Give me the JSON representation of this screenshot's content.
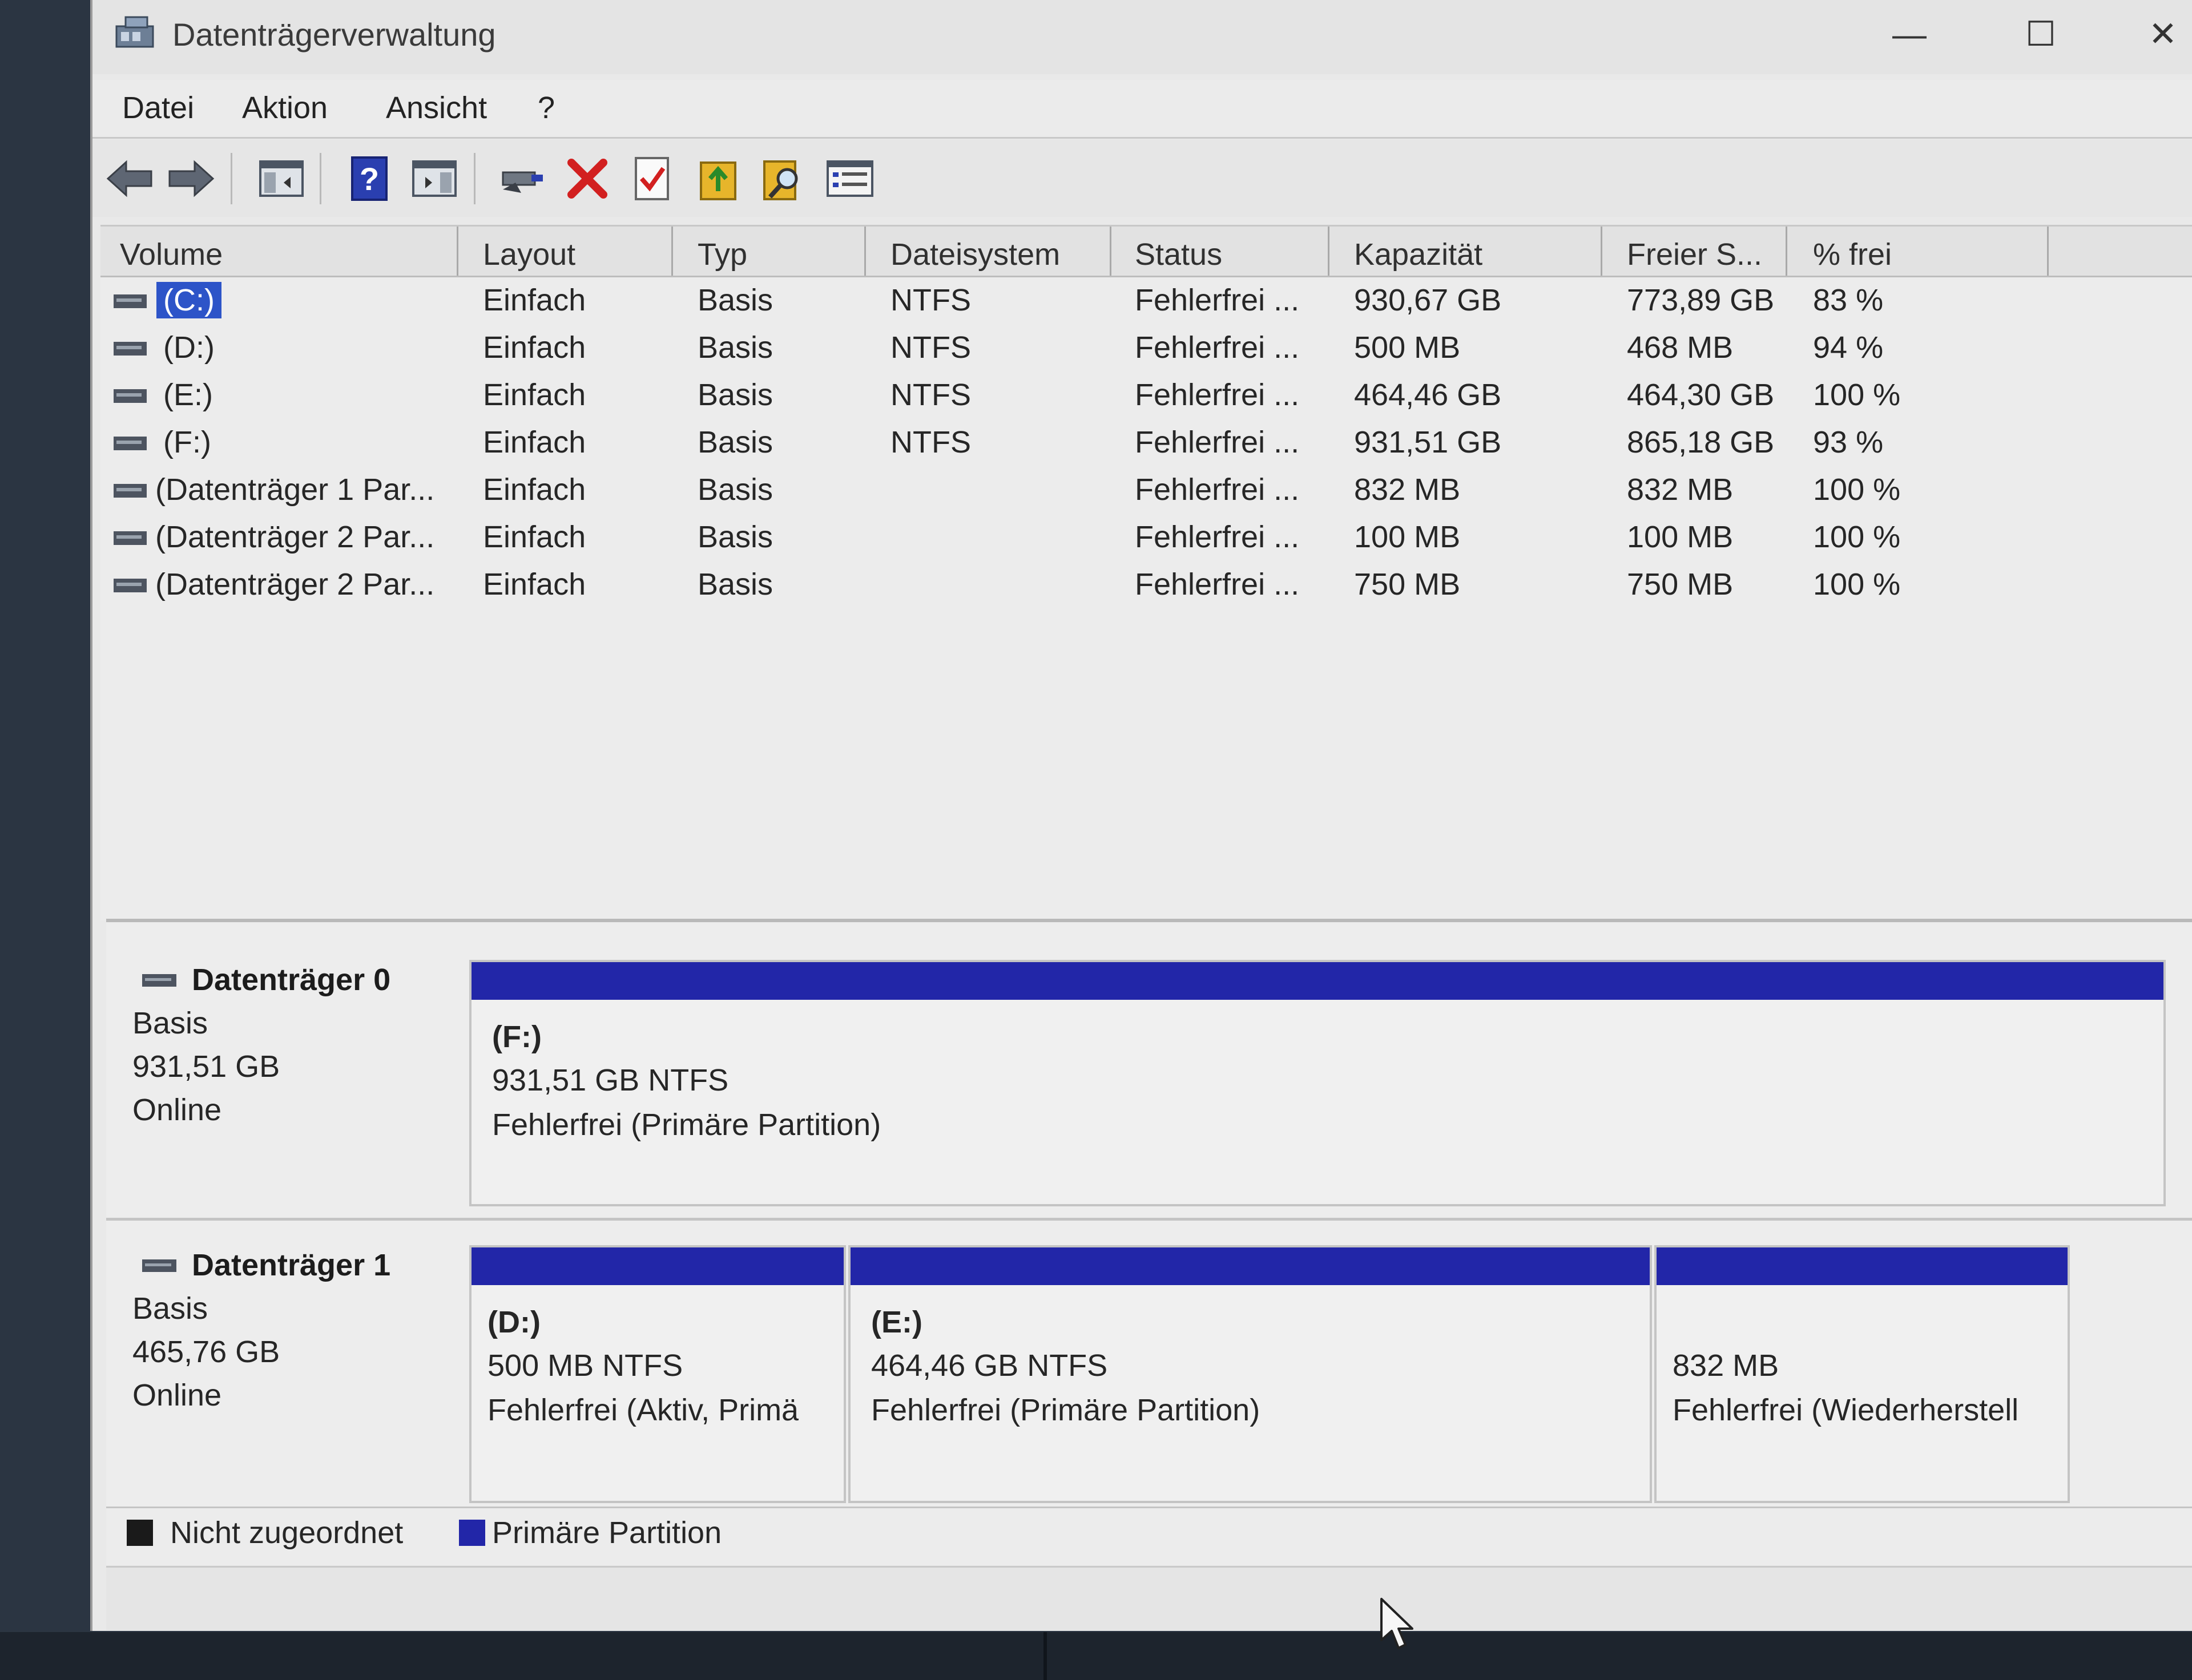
{
  "window": {
    "title": "Datenträgerverwaltung",
    "controls": {
      "minimize": "—",
      "maximize": "☐",
      "close": "✕"
    }
  },
  "menu": [
    "Datei",
    "Aktion",
    "Ansicht",
    "?"
  ],
  "toolbar": [
    "back-arrow-icon",
    "forward-arrow-icon",
    "console-tree-icon",
    "help-icon",
    "action-pane-icon",
    "connect-drive-icon",
    "delete-icon",
    "check-icon",
    "properties-export-icon",
    "search-icon",
    "list-view-icon"
  ],
  "columns": [
    "Volume",
    "Layout",
    "Typ",
    "Dateisystem",
    "Status",
    "Kapazität",
    "Freier S...",
    "% frei"
  ],
  "volumes": [
    {
      "volume": "(C:)",
      "layout": "Einfach",
      "type": "Basis",
      "fs": "NTFS",
      "status": "Fehlerfrei ...",
      "capacity": "930,67 GB",
      "free": "773,89 GB",
      "pct": "83 %"
    },
    {
      "volume": "(D:)",
      "layout": "Einfach",
      "type": "Basis",
      "fs": "NTFS",
      "status": "Fehlerfrei ...",
      "capacity": "500 MB",
      "free": "468 MB",
      "pct": "94 %"
    },
    {
      "volume": "(E:)",
      "layout": "Einfach",
      "type": "Basis",
      "fs": "NTFS",
      "status": "Fehlerfrei ...",
      "capacity": "464,46 GB",
      "free": "464,30 GB",
      "pct": "100 %"
    },
    {
      "volume": "(F:)",
      "layout": "Einfach",
      "type": "Basis",
      "fs": "NTFS",
      "status": "Fehlerfrei ...",
      "capacity": "931,51 GB",
      "free": "865,18 GB",
      "pct": "93 %"
    },
    {
      "volume": "(Datenträger 1 Par...",
      "layout": "Einfach",
      "type": "Basis",
      "fs": "",
      "status": "Fehlerfrei ...",
      "capacity": "832 MB",
      "free": "832 MB",
      "pct": "100 %"
    },
    {
      "volume": "(Datenträger 2 Par...",
      "layout": "Einfach",
      "type": "Basis",
      "fs": "",
      "status": "Fehlerfrei ...",
      "capacity": "100 MB",
      "free": "100 MB",
      "pct": "100 %"
    },
    {
      "volume": "(Datenträger 2 Par...",
      "layout": "Einfach",
      "type": "Basis",
      "fs": "",
      "status": "Fehlerfrei ...",
      "capacity": "750 MB",
      "free": "750 MB",
      "pct": "100 %"
    }
  ],
  "disks": [
    {
      "name": "Datenträger 0",
      "type": "Basis",
      "size": "931,51 GB",
      "state": "Online",
      "partitions": [
        {
          "label": "(F:)",
          "size": "931,51 GB NTFS",
          "status": "Fehlerfrei (Primäre Partition)"
        }
      ]
    },
    {
      "name": "Datenträger 1",
      "type": "Basis",
      "size": "465,76 GB",
      "state": "Online",
      "partitions": [
        {
          "label": "(D:)",
          "size": "500 MB NTFS",
          "status": "Fehlerfrei (Aktiv, Primä"
        },
        {
          "label": "(E:)",
          "size": "464,46 GB NTFS",
          "status": "Fehlerfrei (Primäre Partition)"
        },
        {
          "label": "",
          "size": "832 MB",
          "status": "Fehlerfrei (Wiederherstell"
        }
      ]
    }
  ],
  "legend": [
    {
      "label": "Nicht zugeordnet",
      "color": "#1a1a1a"
    },
    {
      "label": "Primäre Partition",
      "color": "#2226a8"
    }
  ],
  "colors": {
    "partition_bar": "#2226a8",
    "selection": "#2d54c8"
  }
}
